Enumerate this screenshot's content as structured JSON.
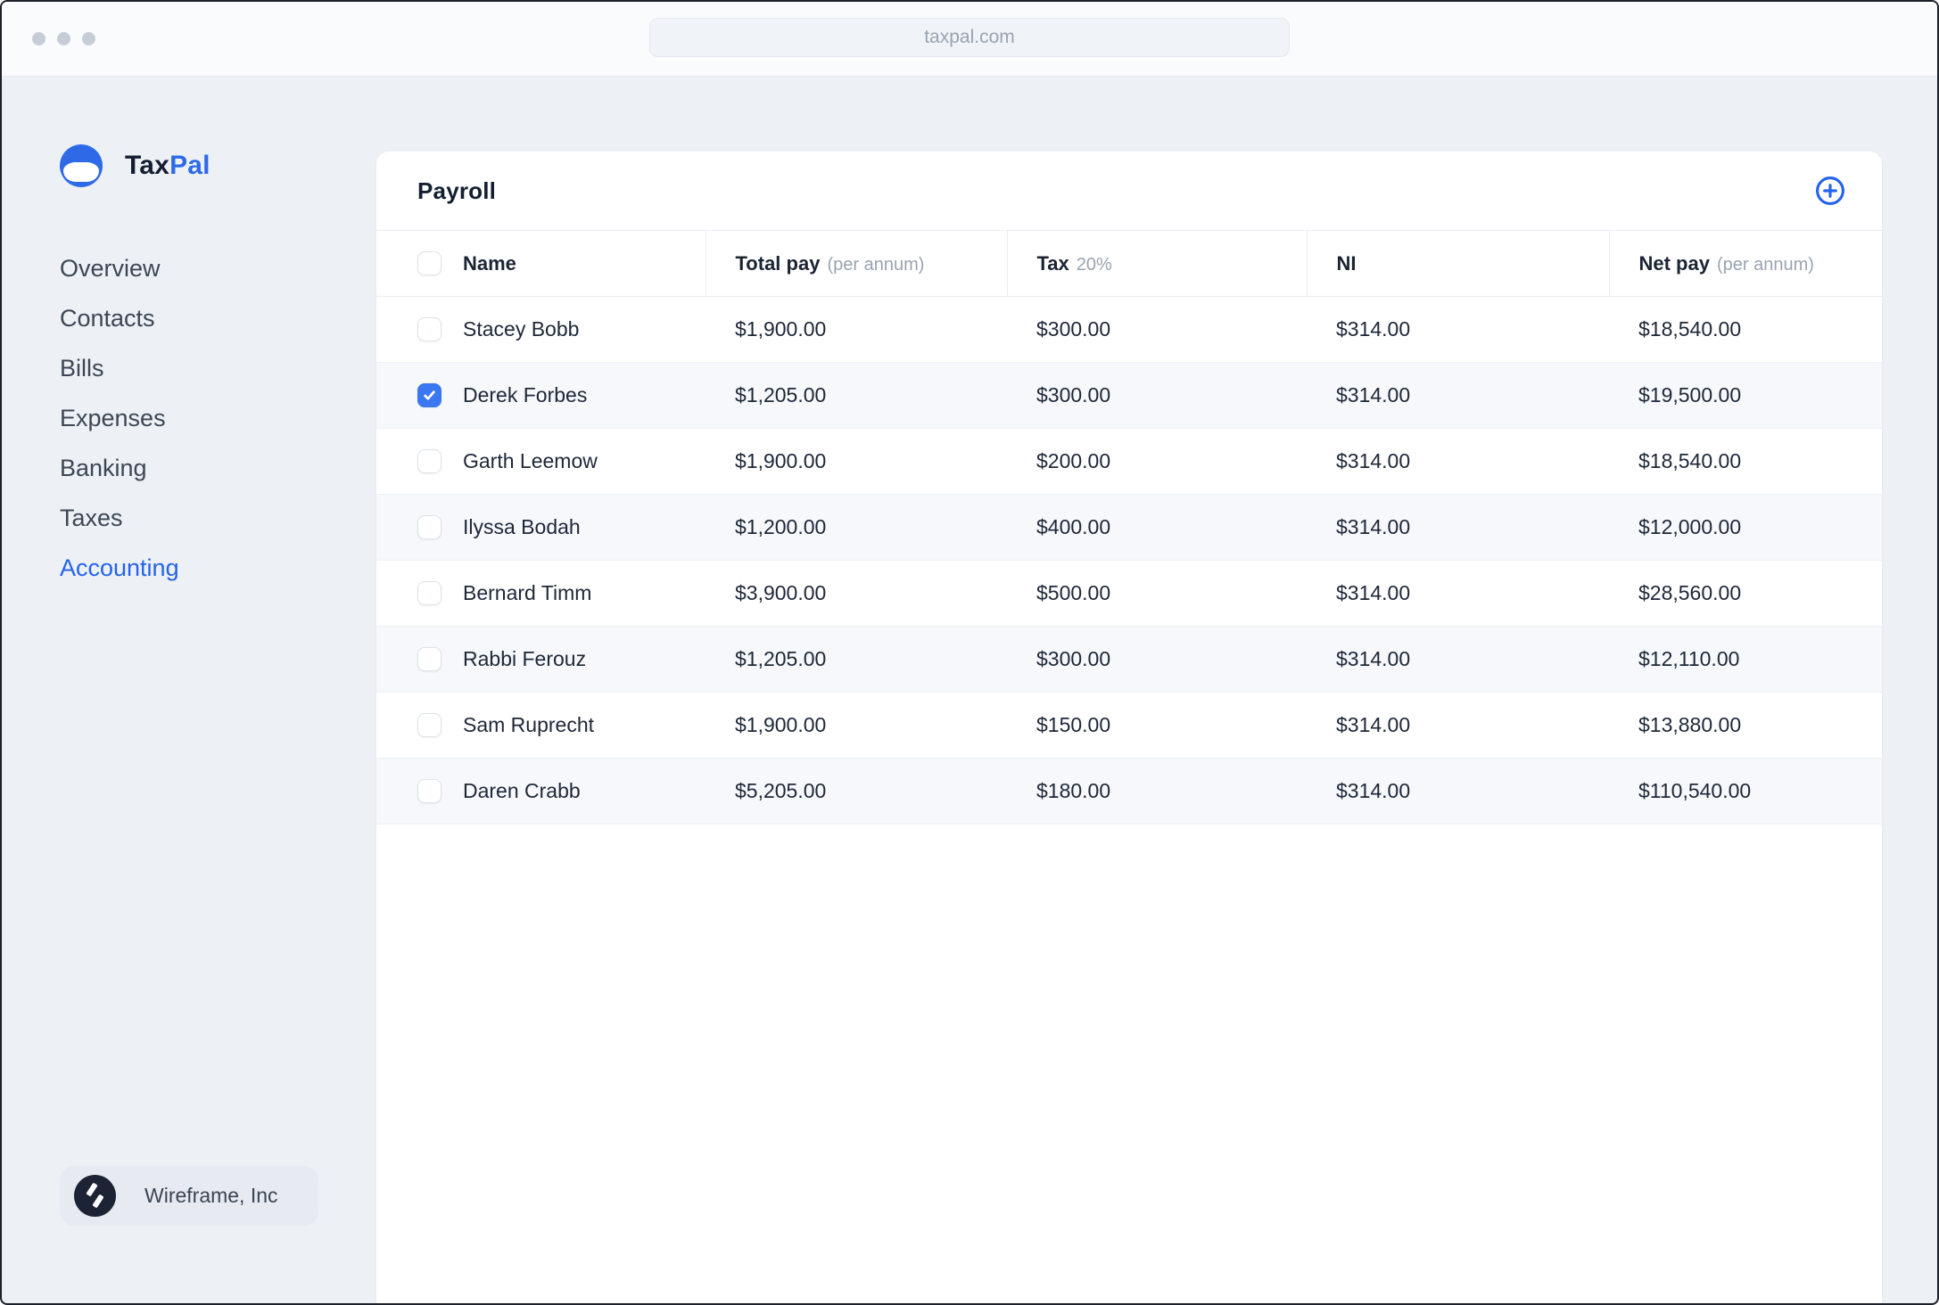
{
  "browser": {
    "url": "taxpal.com"
  },
  "brand": {
    "name_primary": "Tax",
    "name_secondary": "Pal"
  },
  "sidebar": {
    "items": [
      {
        "label": "Overview",
        "active": false
      },
      {
        "label": "Contacts",
        "active": false
      },
      {
        "label": "Bills",
        "active": false
      },
      {
        "label": "Expenses",
        "active": false
      },
      {
        "label": "Banking",
        "active": false
      },
      {
        "label": "Taxes",
        "active": false
      },
      {
        "label": "Accounting",
        "active": true
      }
    ],
    "footer": {
      "company": "Wireframe, Inc"
    }
  },
  "payroll": {
    "title": "Payroll",
    "add_icon": "plus-circle-icon",
    "columns": [
      {
        "label": "Name",
        "sub": ""
      },
      {
        "label": "Total pay",
        "sub": "(per annum)"
      },
      {
        "label": "Tax",
        "sub": "20%"
      },
      {
        "label": "NI",
        "sub": ""
      },
      {
        "label": "Net pay",
        "sub": "(per annum)"
      }
    ],
    "rows": [
      {
        "name": "Stacey Bobb",
        "total": "$1,900.00",
        "tax": "$300.00",
        "ni": "$314.00",
        "net": "$18,540.00",
        "checked": false
      },
      {
        "name": "Derek Forbes",
        "total": "$1,205.00",
        "tax": "$300.00",
        "ni": "$314.00",
        "net": "$19,500.00",
        "checked": true
      },
      {
        "name": "Garth Leemow",
        "total": "$1,900.00",
        "tax": "$200.00",
        "ni": "$314.00",
        "net": "$18,540.00",
        "checked": false
      },
      {
        "name": "Ilyssa Bodah",
        "total": "$1,200.00",
        "tax": "$400.00",
        "ni": "$314.00",
        "net": "$12,000.00",
        "checked": false
      },
      {
        "name": "Bernard Timm",
        "total": "$3,900.00",
        "tax": "$500.00",
        "ni": "$314.00",
        "net": "$28,560.00",
        "checked": false
      },
      {
        "name": "Rabbi Ferouz",
        "total": "$1,205.00",
        "tax": "$300.00",
        "ni": "$314.00",
        "net": "$12,110.00",
        "checked": false
      },
      {
        "name": "Sam Ruprecht",
        "total": "$1,900.00",
        "tax": "$150.00",
        "ni": "$314.00",
        "net": "$13,880.00",
        "checked": false
      },
      {
        "name": "Daren Crabb",
        "total": "$5,205.00",
        "tax": "$180.00",
        "ni": "$314.00",
        "net": "$110,540.00",
        "checked": false
      }
    ]
  },
  "colors": {
    "accent_blue": "#2563eb",
    "checkbox_blue": "#3b76f3",
    "page_bg": "#edf1f6",
    "stripe_bg": "#f6f8fb",
    "text_dark": "#1e2738",
    "text_gray": "#9aa3b0"
  }
}
